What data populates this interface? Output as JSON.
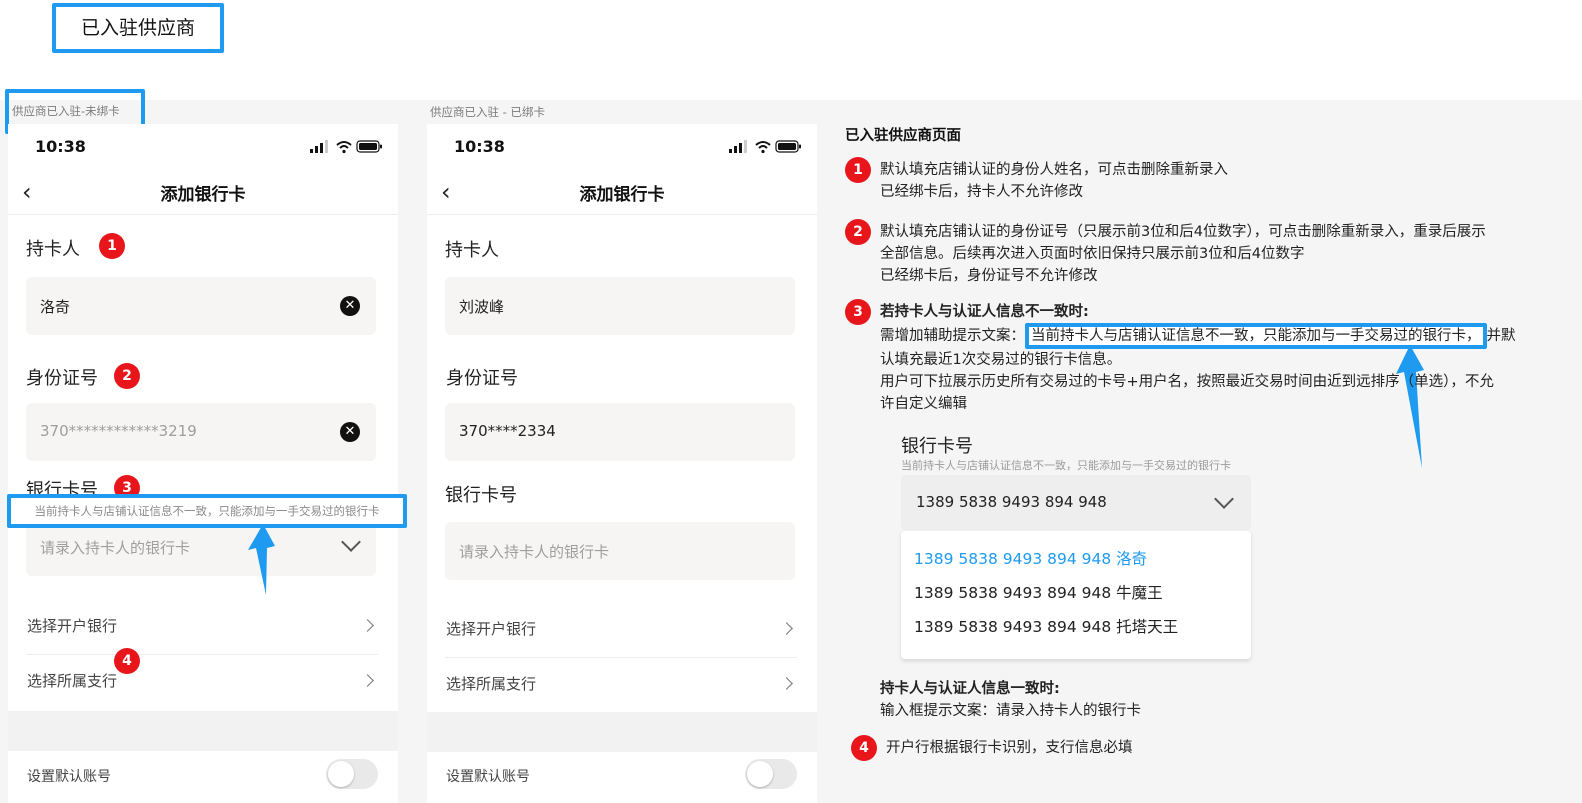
{
  "page_title": "已入驻供应商",
  "frames": {
    "a_label": "供应商已入驻-未绑卡",
    "b_label": "供应商已入驻 - 已绑卡"
  },
  "phone": {
    "time": "10:38",
    "nav_title": "添加银行卡",
    "holder_label": "持卡人",
    "id_label": "身份证号",
    "card_label": "银行卡号",
    "card_placeholder_a": "请录入持卡人的银行卡",
    "card_placeholder_b": "请录入持卡人的银行卡",
    "bank_row": "选择开户银行",
    "branch_row": "选择所属支行",
    "default_row": "设置默认账号"
  },
  "frame_a": {
    "holder_value": "洛奇",
    "id_value": "370************3219",
    "mismatch_hint": "当前持卡人与店铺认证信息不一致，只能添加与一手交易过的银行卡"
  },
  "frame_b": {
    "holder_value": "刘波峰",
    "id_value": "370****2334"
  },
  "badges": [
    "1",
    "2",
    "3",
    "4"
  ],
  "notes": {
    "heading": "已入驻供应商页面",
    "n1_l1": "默认填充店铺认证的身份人姓名，可点击删除重新录入",
    "n1_l2": "已经绑卡后，持卡人不允许修改",
    "n2_l1": "默认填充店铺认证的身份证号（只展示前3位和后4位数字），可点击删除重新录入，重录后展示",
    "n2_l2": "全部信息。后续再次进入页面时依旧保持只展示前3位和后4位数字",
    "n2_l3": "已经绑卡后，身份证号不允许修改",
    "n3_title": "若持卡人与认证人信息不一致时:",
    "n3_prefix": "需增加辅助提示文案：",
    "n3_highlight": "当前持卡人与店铺认证信息不一致，只能添加与一手交易过的银行卡，",
    "n3_suffix": "并默",
    "n3_l2": "认填充最近1次交易过的银行卡信息。",
    "n3_l3": "用户可下拉展示历史所有交易过的卡号+用户名，按照最近交易时间由近到远排序（单选），不允",
    "n3_l4": "许自定义编辑",
    "consistent_title": "持卡人与认证人信息一致时:",
    "consistent_text": "输入框提示文案：请录入持卡人的银行卡",
    "n4": "开户行根据银行卡识别，支行信息必填"
  },
  "demo": {
    "label": "银行卡号",
    "hint": "当前持卡人与店铺认证信息不一致，只能添加与一手交易过的银行卡",
    "selected": "1389 5838 9493 894 948",
    "options": [
      {
        "text": "1389 5838 9493 894 948   洛奇",
        "selected": true
      },
      {
        "text": "1389 5838 9493 894 948   牛魔王",
        "selected": false
      },
      {
        "text": "1389 5838 9493 894 948   托塔天王",
        "selected": false
      }
    ]
  },
  "colors": {
    "annotation_blue": "#1e9bf0",
    "badge_red": "#e8161b",
    "canvas_gray": "#f5f5f5"
  }
}
